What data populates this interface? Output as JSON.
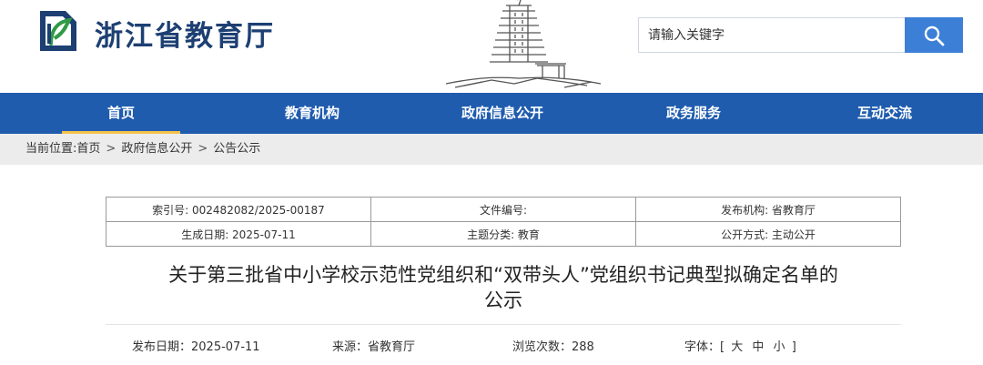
{
  "site": {
    "title": "浙江省教育厅",
    "logo_icon": "education-logo-icon",
    "banner_icon": "pagoda-illustration"
  },
  "search": {
    "placeholder": "请输入关键字",
    "button_icon": "search-icon"
  },
  "colors": {
    "nav_bg": "#1f5cae",
    "search_button": "#3c7fd6",
    "active_underline": "#f3c34a",
    "site_title": "#1d3f72"
  },
  "nav": {
    "items": [
      {
        "label": "首页",
        "active": true
      },
      {
        "label": "教育机构",
        "active": false
      },
      {
        "label": "政府信息公开",
        "active": false
      },
      {
        "label": "政务服务",
        "active": false
      },
      {
        "label": "互动交流",
        "active": false
      }
    ]
  },
  "breadcrumb": {
    "prefix": "当前位置:",
    "items": [
      "首页",
      "政府信息公开",
      "公告公示"
    ],
    "separator": ">"
  },
  "meta": {
    "index_no": "索引号: 002482082/2025-00187",
    "doc_no": "文件编号:",
    "publisher": "发布机构: 省教育厅",
    "created": "生成日期: 2025-07-11",
    "category": "主题分类: 教育",
    "disclosure": "公开方式: 主动公开"
  },
  "article": {
    "title_line1": "关于第三批省中小学校示范性党组织和“双带头人”党组织书记典型拟确定名单的",
    "title_line2": "公示",
    "publish_date": "发布日期：2025-07-11",
    "source": "来源：省教育厅",
    "views": "浏览次数：288",
    "font_label": "字体：",
    "font_open": "[",
    "font_large": "大",
    "font_medium": "中",
    "font_small": "小",
    "font_close": "]"
  }
}
